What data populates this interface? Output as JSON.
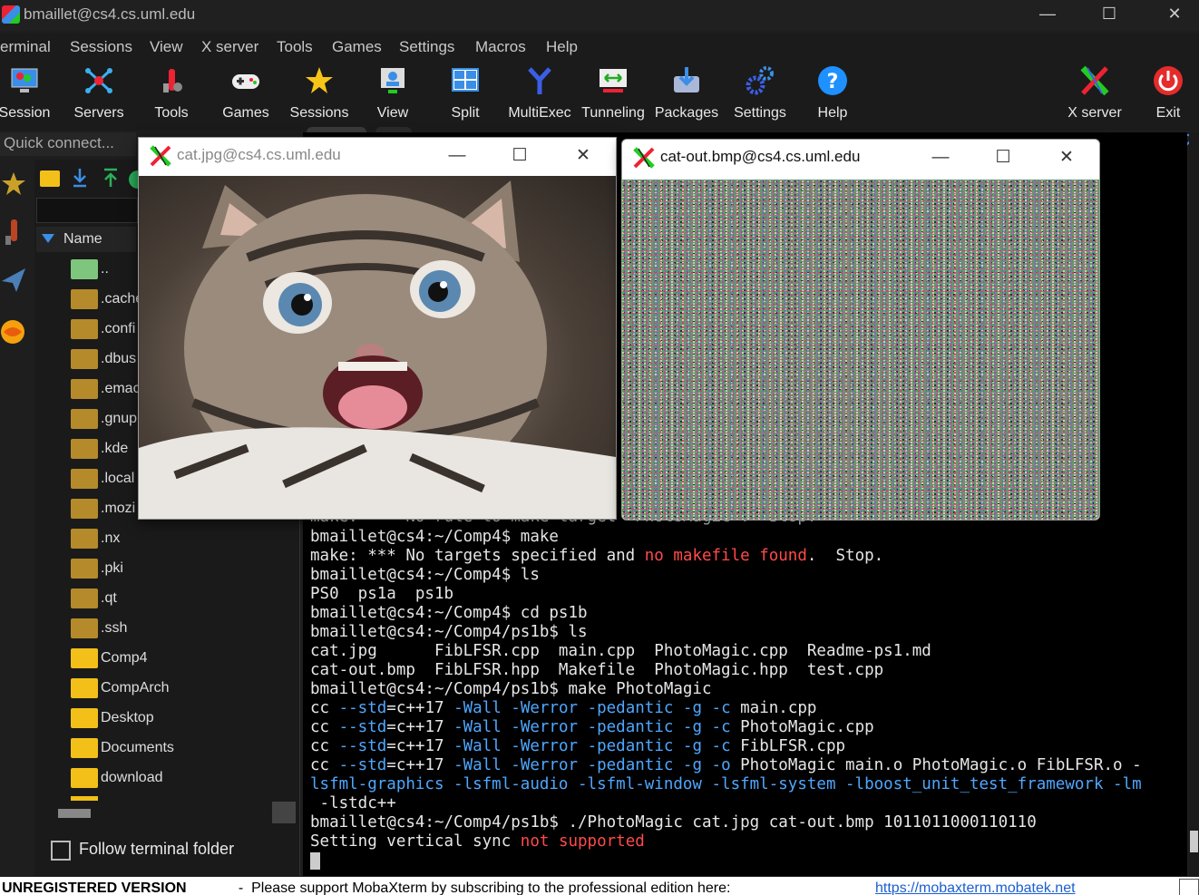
{
  "window": {
    "title": "bmaillet@cs4.cs.uml.edu",
    "minimize": "—",
    "maximize": "☐",
    "close": "✕"
  },
  "menu": [
    "erminal",
    "Sessions",
    "View",
    "X server",
    "Tools",
    "Games",
    "Settings",
    "Macros",
    "Help"
  ],
  "toolbar": [
    {
      "label": "Session",
      "icon": "session-icon"
    },
    {
      "label": "Servers",
      "icon": "servers-icon"
    },
    {
      "label": "Tools",
      "icon": "tools-icon"
    },
    {
      "label": "Games",
      "icon": "gamepad-icon"
    },
    {
      "label": "Sessions",
      "icon": "star-icon"
    },
    {
      "label": "View",
      "icon": "view-icon"
    },
    {
      "label": "Split",
      "icon": "split-icon"
    },
    {
      "label": "MultiExec",
      "icon": "multiexec-icon"
    },
    {
      "label": "Tunneling",
      "icon": "tunneling-icon"
    },
    {
      "label": "Packages",
      "icon": "packages-icon"
    },
    {
      "label": "Settings",
      "icon": "settings-gears-icon"
    },
    {
      "label": "Help",
      "icon": "help-icon"
    },
    {
      "label": "X server",
      "icon": "xserver-icon"
    },
    {
      "label": "Exit",
      "icon": "power-icon"
    }
  ],
  "quick_connect": "Quick connect...",
  "sidebar": {
    "column_header": "Name",
    "items": [
      {
        "name": "..",
        "type": "up"
      },
      {
        "name": ".cache",
        "type": "hidden"
      },
      {
        "name": ".confi",
        "type": "hidden"
      },
      {
        "name": ".dbus",
        "type": "hidden"
      },
      {
        "name": ".emac",
        "type": "hidden"
      },
      {
        "name": ".gnup",
        "type": "hidden"
      },
      {
        "name": ".kde",
        "type": "hidden"
      },
      {
        "name": ".local",
        "type": "hidden"
      },
      {
        "name": ".mozi",
        "type": "hidden"
      },
      {
        "name": ".nx",
        "type": "hidden"
      },
      {
        "name": ".pki",
        "type": "hidden"
      },
      {
        "name": ".qt",
        "type": "hidden"
      },
      {
        "name": ".ssh",
        "type": "hidden"
      },
      {
        "name": "Comp4",
        "type": "folder"
      },
      {
        "name": "CompArch",
        "type": "folder"
      },
      {
        "name": "Desktop",
        "type": "folder"
      },
      {
        "name": "Documents",
        "type": "folder"
      },
      {
        "name": "download",
        "type": "folder"
      }
    ],
    "follow_terminal_folder": "Follow terminal folder"
  },
  "xwindows": {
    "left": {
      "title": "cat.jpg@cs4.cs.uml.edu"
    },
    "right": {
      "title": "cat-out.bmp@cs4.cs.uml.edu"
    }
  },
  "terminal": {
    "partial_top": "make: *** No rule to make target 'PhotoMagic'.  Stop.",
    "lines": [
      "bmaillet@cs4:~/Comp4$ make",
      "bmaillet@cs4:~/Comp4$ ls",
      "PS0  ps1a  ps1b",
      "bmaillet@cs4:~/Comp4$ cd ps1b",
      "bmaillet@cs4:~/Comp4/ps1b$ ls",
      "cat.jpg      FibLFSR.cpp  main.cpp  PhotoMagic.cpp  Readme-ps1.md",
      "cat-out.bmp  FibLFSR.hpp  Makefile  PhotoMagic.hpp  test.cpp",
      "bmaillet@cs4:~/Comp4/ps1b$ make PhotoMagic",
      " -lstdc++",
      "bmaillet@cs4:~/Comp4/ps1b$ ./PhotoMagic cat.jpg cat-out.bmp 1011011000110110"
    ],
    "make_error": {
      "a": "make: *** No targets specified and ",
      "b": "no makefile found",
      "c": ".  Stop."
    },
    "compile": [
      {
        "cc": "cc ",
        "std": "--std",
        "v": "=c++17 ",
        "w": "-Wall -Werror -pedantic -g -c",
        "f": " main.cpp"
      },
      {
        "cc": "cc ",
        "std": "--std",
        "v": "=c++17 ",
        "w": "-Wall -Werror -pedantic -g -c",
        "f": " PhotoMagic.cpp"
      },
      {
        "cc": "cc ",
        "std": "--std",
        "v": "=c++17 ",
        "w": "-Wall -Werror -pedantic -g -c",
        "f": " FibLFSR.cpp"
      },
      {
        "cc": "cc ",
        "std": "--std",
        "v": "=c++17 ",
        "w": "-Wall -Werror -pedantic -g -o",
        "f": " PhotoMagic main.o PhotoMagic.o FibLFSR.o -"
      }
    ],
    "link_flags": "lsfml-graphics -lsfml-audio -lsfml-window -lsfml-system -lboost_unit_test_framework -lm",
    "vsync": {
      "a": "Setting vertical sync ",
      "b": "not supported"
    }
  },
  "status": {
    "unregistered": "UNREGISTERED VERSION",
    "message": "  -  Please support MobaXterm by subscribing to the professional edition here:  ",
    "link": "https://mobaxterm.mobatek.net"
  },
  "colors": {
    "accent": "#3a8ee6",
    "folder": "#f2c018",
    "hidden_folder": "#b58a2a",
    "terminal_blue": "#4fa7ff",
    "terminal_red": "#ff4a4a"
  }
}
